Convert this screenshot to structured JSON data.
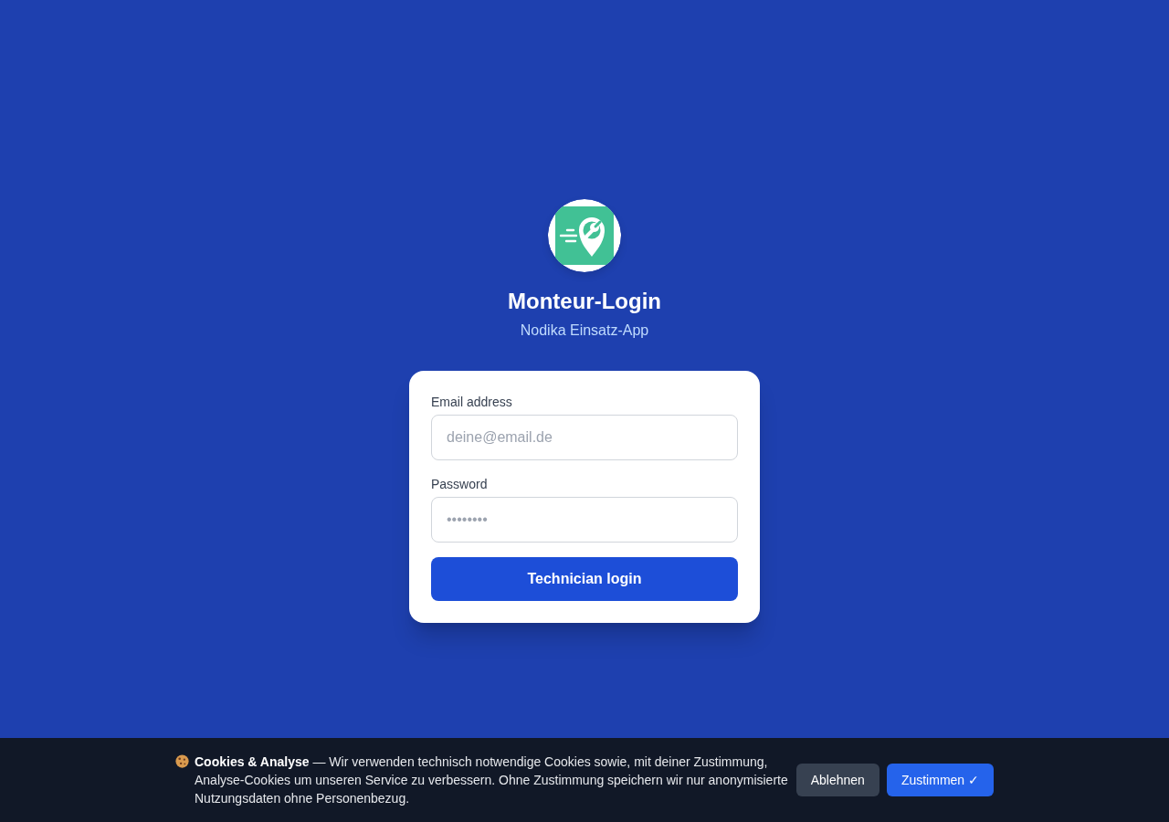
{
  "header": {
    "title": "Monteur-Login",
    "subtitle": "Nodika Einsatz-App"
  },
  "login_form": {
    "fields": [
      {
        "label": "Email address",
        "placeholder": "deine@email.de"
      },
      {
        "label": "Password",
        "placeholder": "••••••••"
      }
    ],
    "submit_button": "Technician login"
  },
  "cookie_banner": {
    "text": "**Cookies & Analyse** — Wir verwenden technisch notwendige Cookies sowie, mit deiner Zustimmung, Analyse-Cookies um unseren Service zu verbessern. Ohne Zustimmung speichern wir nur anonymisierte Nutzungsdaten ohne Personenbezug.",
    "buttons": [
      {
        "kind": "secondary",
        "label": "Ablehnen"
      },
      {
        "kind": "primary",
        "label": "Zustimmen ✓"
      }
    ]
  }
}
